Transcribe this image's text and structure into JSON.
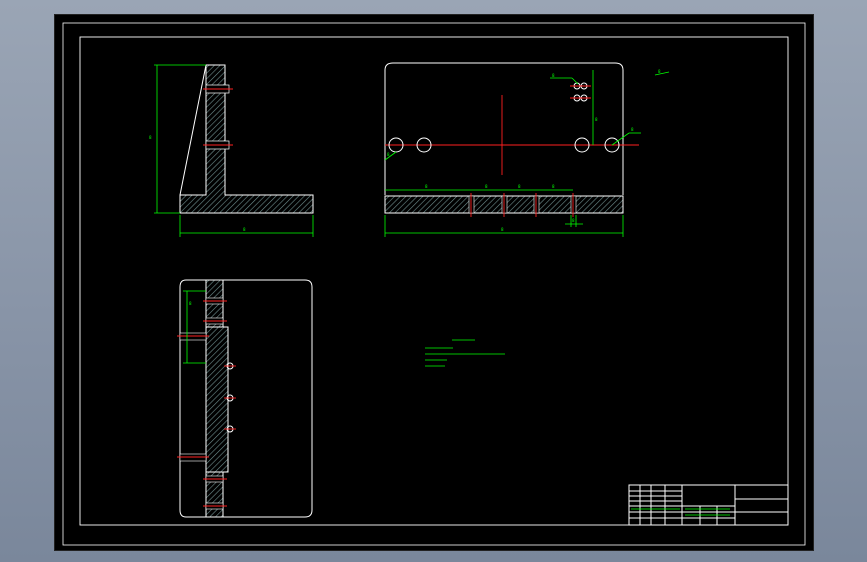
{
  "drawing": {
    "colors": {
      "background": "#000000",
      "outline": "#ffffff",
      "dimension": "#00ff00",
      "centerline": "#ff2020",
      "hatch": "#6f8f8f",
      "desktop": "#8793a6"
    },
    "dimension_marks": {
      "front_height": "8",
      "front_width": "8",
      "top_width": "8",
      "top_seg1": "8",
      "top_seg2": "8",
      "top_seg3": "8",
      "top_seg4": "8",
      "hole_small": "8",
      "hole_large": "8",
      "side_a": "8",
      "side_b": "8",
      "vertical_offset": "8",
      "corner_note": "8"
    }
  }
}
